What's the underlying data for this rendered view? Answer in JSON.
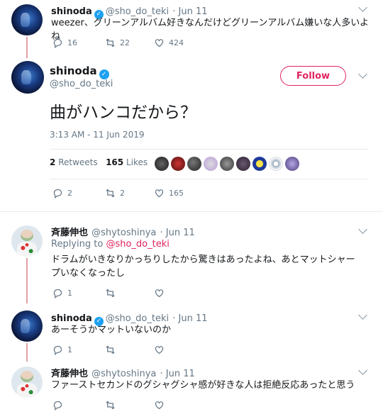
{
  "tweets": [
    {
      "name": "shinoda",
      "handle": "@sho_do_teki",
      "time": "· Jun 11",
      "text": "weezer、グリーンアルバム好きなんだけどグリーンアルバム嫌いな人多いよね",
      "replies": "16",
      "retweets": "22",
      "likes": "424"
    }
  ],
  "focus": {
    "name": "shinoda",
    "handle": "@sho_do_teki",
    "follow_label": "Follow",
    "text": "曲がハンコだから？",
    "timestamp": "3:13 AM - 11 Jun 2019",
    "retweets_count": "2",
    "retweets_label": "Retweets",
    "likes_count": "165",
    "likes_label": "Likes",
    "replies": "2",
    "retweets": "2",
    "likes": "165"
  },
  "replies": [
    {
      "name": "斉藤伸也",
      "handle": "@shytoshinya",
      "time": "· Jun 11",
      "replying_prefix": "Replying to",
      "replying_to": "@sho_do_teki",
      "text": "ドラムがいきなりかっちりしたから驚きはあったよね、あとマットシャープいなくなったし",
      "replies": "1"
    },
    {
      "name": "shinoda",
      "handle": "@sho_do_teki",
      "time": "· Jun 11",
      "text": "あーそうかマットいないのか",
      "replies": "1"
    },
    {
      "name": "斉藤伸也",
      "handle": "@shytoshinya",
      "time": "· Jun 11",
      "text": "ファーストセカンドのグシャグシャ感が好きな人は拒絶反応あったと思う"
    }
  ],
  "colors": {
    "accent": "#e0245e",
    "verified": "#1da1f2",
    "muted": "#657786",
    "thread_line": "#e0a0a6"
  },
  "icons": [
    "reply-icon",
    "retweet-icon",
    "like-icon",
    "verified-icon",
    "chevron-down-icon"
  ]
}
